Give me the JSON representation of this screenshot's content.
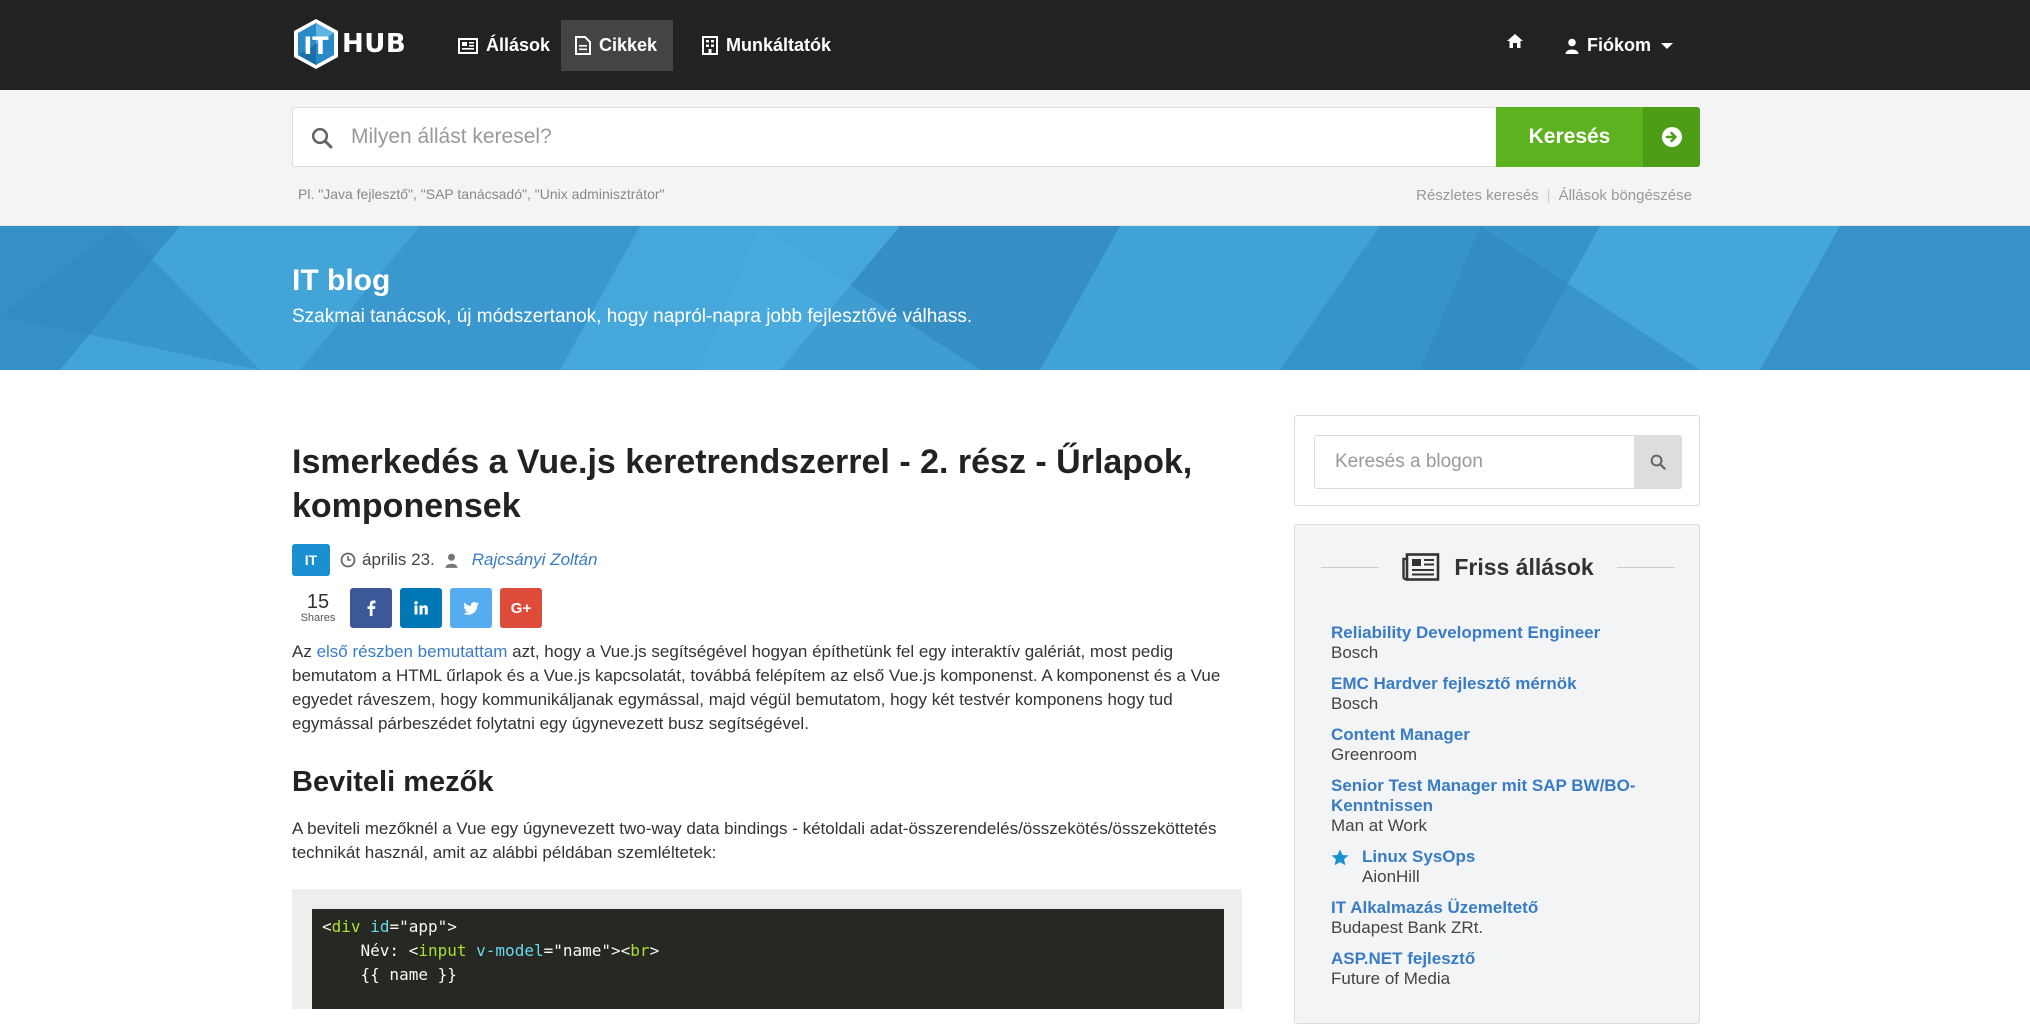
{
  "brand": {
    "logo_letters": "IT",
    "logo_text": "HUB"
  },
  "nav": {
    "items": [
      {
        "label": "Állások",
        "icon": "newspaper-icon"
      },
      {
        "label": "Cikkek",
        "icon": "document-icon",
        "active": true
      },
      {
        "label": "Munkáltatók",
        "icon": "building-icon"
      }
    ],
    "home_icon": "home-icon",
    "account_label": "Fiókom"
  },
  "search": {
    "placeholder": "Milyen állást keresel?",
    "button_label": "Keresés",
    "hint": "Pl. \"Java fejlesztő\", \"SAP tanácsadó\", \"Unix adminisztrátor\"",
    "link_advanced": "Részletes keresés",
    "link_browse": "Állások böngészése"
  },
  "hero": {
    "title": "IT blog",
    "subtitle": "Szakmai tanácsok, új módszertanok, hogy napról-napra jobb fejlesztővé válhass."
  },
  "article": {
    "title": "Ismerkedés a Vue.js keretrendszerrel - 2. rész - Űrlapok, komponensek",
    "tag": "IT",
    "date": "április 23.",
    "author": "Rajcsányi Zoltán",
    "shares_count": "15",
    "shares_label": "Shares",
    "intro_prefix": "Az ",
    "intro_link": "első részben bemutattam",
    "intro_rest": " azt, hogy a Vue.js segítségével hogyan építhetünk fel egy interaktív galériát, most pedig bemutatom a HTML űrlapok és a Vue.js kapcsolatát, továbbá felépítem az első Vue.js komponenst. A komponenst és a Vue egyedet ráveszem, hogy kommunikáljanak egymással, majd végül bemutatom, hogy két testvér komponens hogy tud egymással párbeszédet folytatni egy úgynevezett busz segítségével.",
    "section_title": "Beviteli mezők",
    "section_text": "A beviteli mezőknél a Vue egy úgynevezett two-way data bindings - kétoldali adat-összerendelés/összekötés/összeköttetés technikát használ, amit az alábbi példában szemléltetek:",
    "code": {
      "line1_tag": "div",
      "line1_attr": "id",
      "line1_val": "\"app\"",
      "line2_label": "Név: ",
      "line2_tag": "input",
      "line2_attr": "v-model",
      "line2_val": "\"name\"",
      "line2_br": "br",
      "line3": "{{ name }}"
    }
  },
  "sidebar": {
    "search_placeholder": "Keresés a blogon",
    "jobs_title": "Friss állások",
    "jobs": [
      {
        "title": "Reliability Development Engineer",
        "company": "Bosch",
        "starred": false
      },
      {
        "title": "EMC Hardver fejlesztő mérnök",
        "company": "Bosch",
        "starred": false
      },
      {
        "title": "Content Manager",
        "company": "Greenroom",
        "starred": false
      },
      {
        "title": "Senior Test Manager mit SAP BW/BO-Kenntnissen",
        "company": "Man at Work",
        "starred": false
      },
      {
        "title": "Linux SysOps",
        "company": "AionHill",
        "starred": true
      },
      {
        "title": "IT Alkalmazás Üzemeltető",
        "company": "Budapest Bank ZRt.",
        "starred": false
      },
      {
        "title": "ASP.NET fejlesztő",
        "company": "Future of Media",
        "starred": false
      }
    ]
  },
  "colors": {
    "navbar": "#222222",
    "search_button": "#5cb21f",
    "hero": "#3b9bd0",
    "link": "#3a7cc4",
    "tag": "#1a8fd1",
    "facebook": "#3b5998",
    "linkedin": "#0077b5",
    "twitter": "#55acee",
    "google_plus": "#dd4b39"
  }
}
